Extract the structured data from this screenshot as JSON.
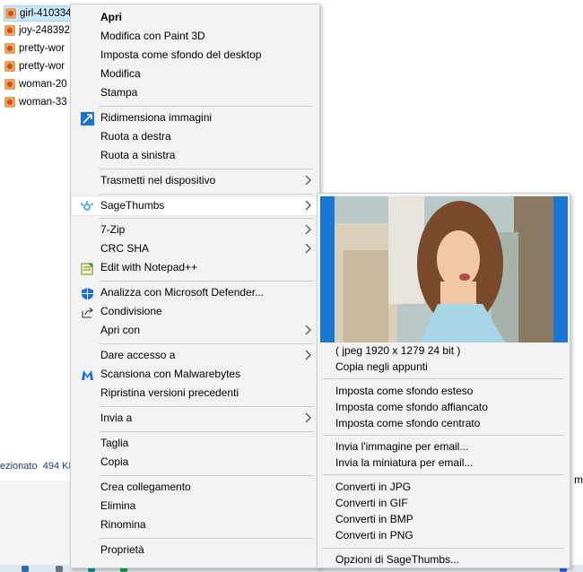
{
  "background": {
    "files": [
      {
        "name": "girl-410334",
        "selected": true
      },
      {
        "name": "joy-248392",
        "selected": false
      },
      {
        "name": "pretty-wor",
        "selected": false
      },
      {
        "name": "pretty-wor",
        "selected": false
      },
      {
        "name": "woman-20",
        "selected": false
      },
      {
        "name": "woman-33",
        "selected": false
      }
    ],
    "status_selected": "ezionato",
    "status_size": "494 KB",
    "right_text": "m"
  },
  "menu": {
    "items": [
      {
        "label": "Apri",
        "icon": "",
        "bold": true
      },
      {
        "label": "Modifica con Paint 3D",
        "icon": ""
      },
      {
        "label": "Imposta come sfondo del desktop",
        "icon": ""
      },
      {
        "label": "Modifica",
        "icon": ""
      },
      {
        "label": "Stampa",
        "icon": ""
      },
      {
        "label": "Ridimensiona immagini",
        "icon": "resize-icon"
      },
      {
        "label": "Ruota a destra",
        "icon": ""
      },
      {
        "label": "Ruota a sinistra",
        "icon": ""
      },
      {
        "label": "Trasmetti nel dispositivo",
        "icon": "",
        "submenu": true
      },
      {
        "label": "SageThumbs",
        "icon": "sagethumbs-icon",
        "submenu": true,
        "highlighted": true
      },
      {
        "label": "7-Zip",
        "icon": "",
        "submenu": true
      },
      {
        "label": "CRC SHA",
        "icon": "",
        "submenu": true
      },
      {
        "label": "Edit with Notepad++",
        "icon": "notepad-icon"
      },
      {
        "label": "Analizza con Microsoft Defender...",
        "icon": "defender-icon"
      },
      {
        "label": "Condivisione",
        "icon": "share-icon"
      },
      {
        "label": "Apri con",
        "icon": "",
        "submenu": true
      },
      {
        "label": "Dare accesso a",
        "icon": "",
        "submenu": true
      },
      {
        "label": "Scansiona con Malwarebytes",
        "icon": "malwarebytes-icon"
      },
      {
        "label": "Ripristina versioni precedenti",
        "icon": ""
      },
      {
        "label": "Invia a",
        "icon": "",
        "submenu": true
      },
      {
        "label": "Taglia",
        "icon": ""
      },
      {
        "label": "Copia",
        "icon": ""
      },
      {
        "label": "Crea collegamento",
        "icon": ""
      },
      {
        "label": "Elimina",
        "icon": ""
      },
      {
        "label": "Rinomina",
        "icon": ""
      },
      {
        "label": "Proprietà",
        "icon": ""
      }
    ]
  },
  "submenu": {
    "preview_alt": "photo-preview",
    "items": [
      {
        "label": "( jpeg 1920 x 1279 24 bit )"
      },
      {
        "label": "Copia negli appunti"
      },
      {
        "label": "Imposta come sfondo esteso"
      },
      {
        "label": "Imposta come sfondo affiancato"
      },
      {
        "label": "Imposta come sfondo centrato"
      },
      {
        "label": "Invia l'immagine per email..."
      },
      {
        "label": "Invia la miniatura per email..."
      },
      {
        "label": "Converti in JPG"
      },
      {
        "label": "Converti in GIF"
      },
      {
        "label": "Converti in BMP"
      },
      {
        "label": "Converti in PNG"
      },
      {
        "label": "Opzioni di SageThumbs..."
      }
    ]
  },
  "colors": {
    "menu_bg": "#f2f2f2",
    "highlight": "#ffffff",
    "selection": "#cce8ff",
    "accent_blue": "#1976d2"
  }
}
